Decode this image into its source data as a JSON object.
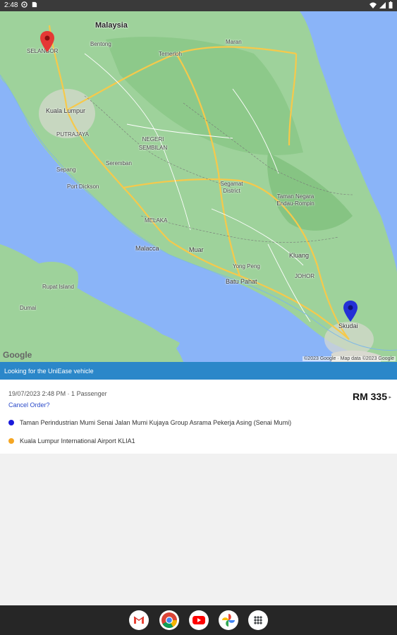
{
  "status_bar": {
    "time": "2:48"
  },
  "map": {
    "labels": {
      "malaysia": "Malaysia",
      "selangor": "SELANGOR",
      "kuala_lumpur": "Kuala Lumpur",
      "putrajaya": "PUTRAJAYA",
      "sepang": "Sepang",
      "port_dickson": "Port Dickson",
      "seremban": "Seremban",
      "negeri_sembilan": "NEGERI SEMBILAN",
      "melaka": "MELAKA",
      "malacca": "Malacca",
      "muar": "Muar",
      "batu_pahat": "Batu Pahat",
      "kluang": "Kluang",
      "johor": "JOHOR",
      "skudai": "Skudai",
      "temerloh": "Temerloh",
      "bentong": "Bentong",
      "maran": "Maran",
      "segamat_district": "Segamat District",
      "taman_negara": "Taman Negara Endau-Rompin",
      "rupat_island": "Rupat Island",
      "dumai": "Dumai",
      "yong_peng": "Yong Peng"
    },
    "google": "Google",
    "attribution": "©2023 Google · Map data ©2023 Google"
  },
  "banner": {
    "text": "Looking for the UniEase vehicle"
  },
  "order": {
    "datetime_passengers": "19/07/2023 2:48 PM · 1 Passenger",
    "cancel_label": "Cancel Order?",
    "price": "RM 335",
    "pickup": "Taman Perindustrian Mumi Senai Jalan Mumi Kujaya Group Asrama Pekerja Asing (Senai Mumi)",
    "dropoff": "Kuala Lumpur International Airport KLIA1"
  },
  "colors": {
    "banner": "#2b87c9",
    "pickup_dot": "#1a1adb",
    "dropoff_dot": "#f5a623",
    "origin_pin": "#e53935",
    "destination_pin": "#2430d6"
  },
  "dock": {
    "apps": [
      "gmail-icon",
      "chrome-icon",
      "youtube-icon",
      "photos-icon",
      "app-drawer-icon"
    ]
  }
}
